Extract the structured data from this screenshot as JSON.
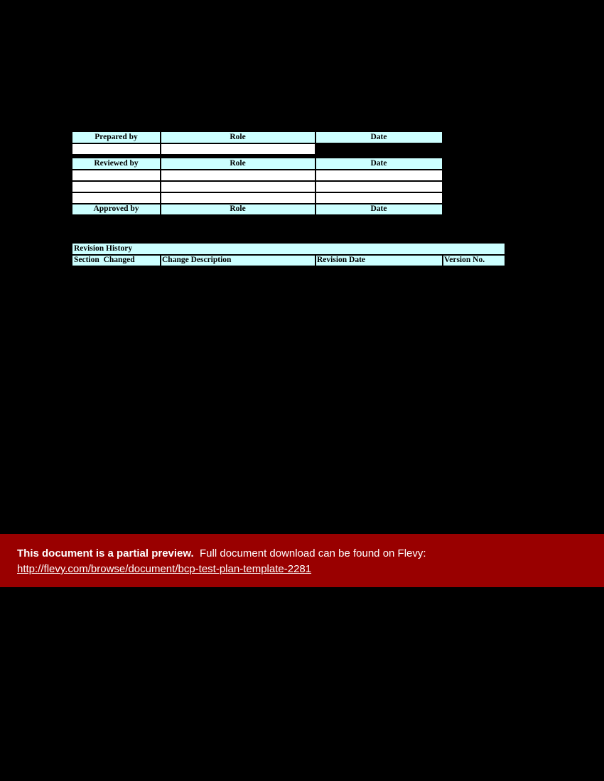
{
  "document": {
    "background_color": "#000000",
    "header_fill": "#CCFFFF",
    "cell_fill": "#FFFFFF",
    "border_color": "#000000",
    "promo_color": "#990000"
  },
  "approval_table": {
    "name": "approval-signoff-table",
    "rows": [
      {
        "type": "header",
        "cells": [
          {
            "text": "Prepared by",
            "style": "hdr"
          },
          {
            "text": "Role",
            "style": "hdr"
          },
          {
            "text": "Date",
            "style": "hdr"
          }
        ]
      },
      {
        "type": "data",
        "cells": [
          {
            "text": "",
            "style": "blank"
          },
          {
            "text": "",
            "style": "blank"
          },
          {
            "text": "",
            "style": "blackcell"
          }
        ]
      },
      {
        "type": "header",
        "cells": [
          {
            "text": "Reviewed by",
            "style": "hdr"
          },
          {
            "text": "Role",
            "style": "hdr"
          },
          {
            "text": "Date",
            "style": "hdr"
          }
        ]
      },
      {
        "type": "data",
        "cells": [
          {
            "text": "",
            "style": "blank"
          },
          {
            "text": "",
            "style": "blank"
          },
          {
            "text": "",
            "style": "blank"
          }
        ]
      },
      {
        "type": "data",
        "cells": [
          {
            "text": "",
            "style": "blank"
          },
          {
            "text": "",
            "style": "blank"
          },
          {
            "text": "",
            "style": "blank"
          }
        ]
      },
      {
        "type": "data",
        "cells": [
          {
            "text": "",
            "style": "blank"
          },
          {
            "text": "",
            "style": "blank"
          },
          {
            "text": "",
            "style": "blank"
          }
        ]
      },
      {
        "type": "header",
        "cells": [
          {
            "text": "Approved by",
            "style": "hdr"
          },
          {
            "text": "Role",
            "style": "hdr"
          },
          {
            "text": "Date",
            "style": "hdr"
          }
        ]
      }
    ]
  },
  "revision_table": {
    "name": "revision-history-table",
    "title": "Revision History",
    "columns": [
      "Section  Changed",
      "Change Description",
      "Revision Date",
      "Version No."
    ]
  },
  "promo": {
    "strong_text": "This document is a partial preview.",
    "rest_text": "Full document download can be found on Flevy:",
    "url": "http://flevy.com/browse/document/bcp-test-plan-template-2281"
  }
}
